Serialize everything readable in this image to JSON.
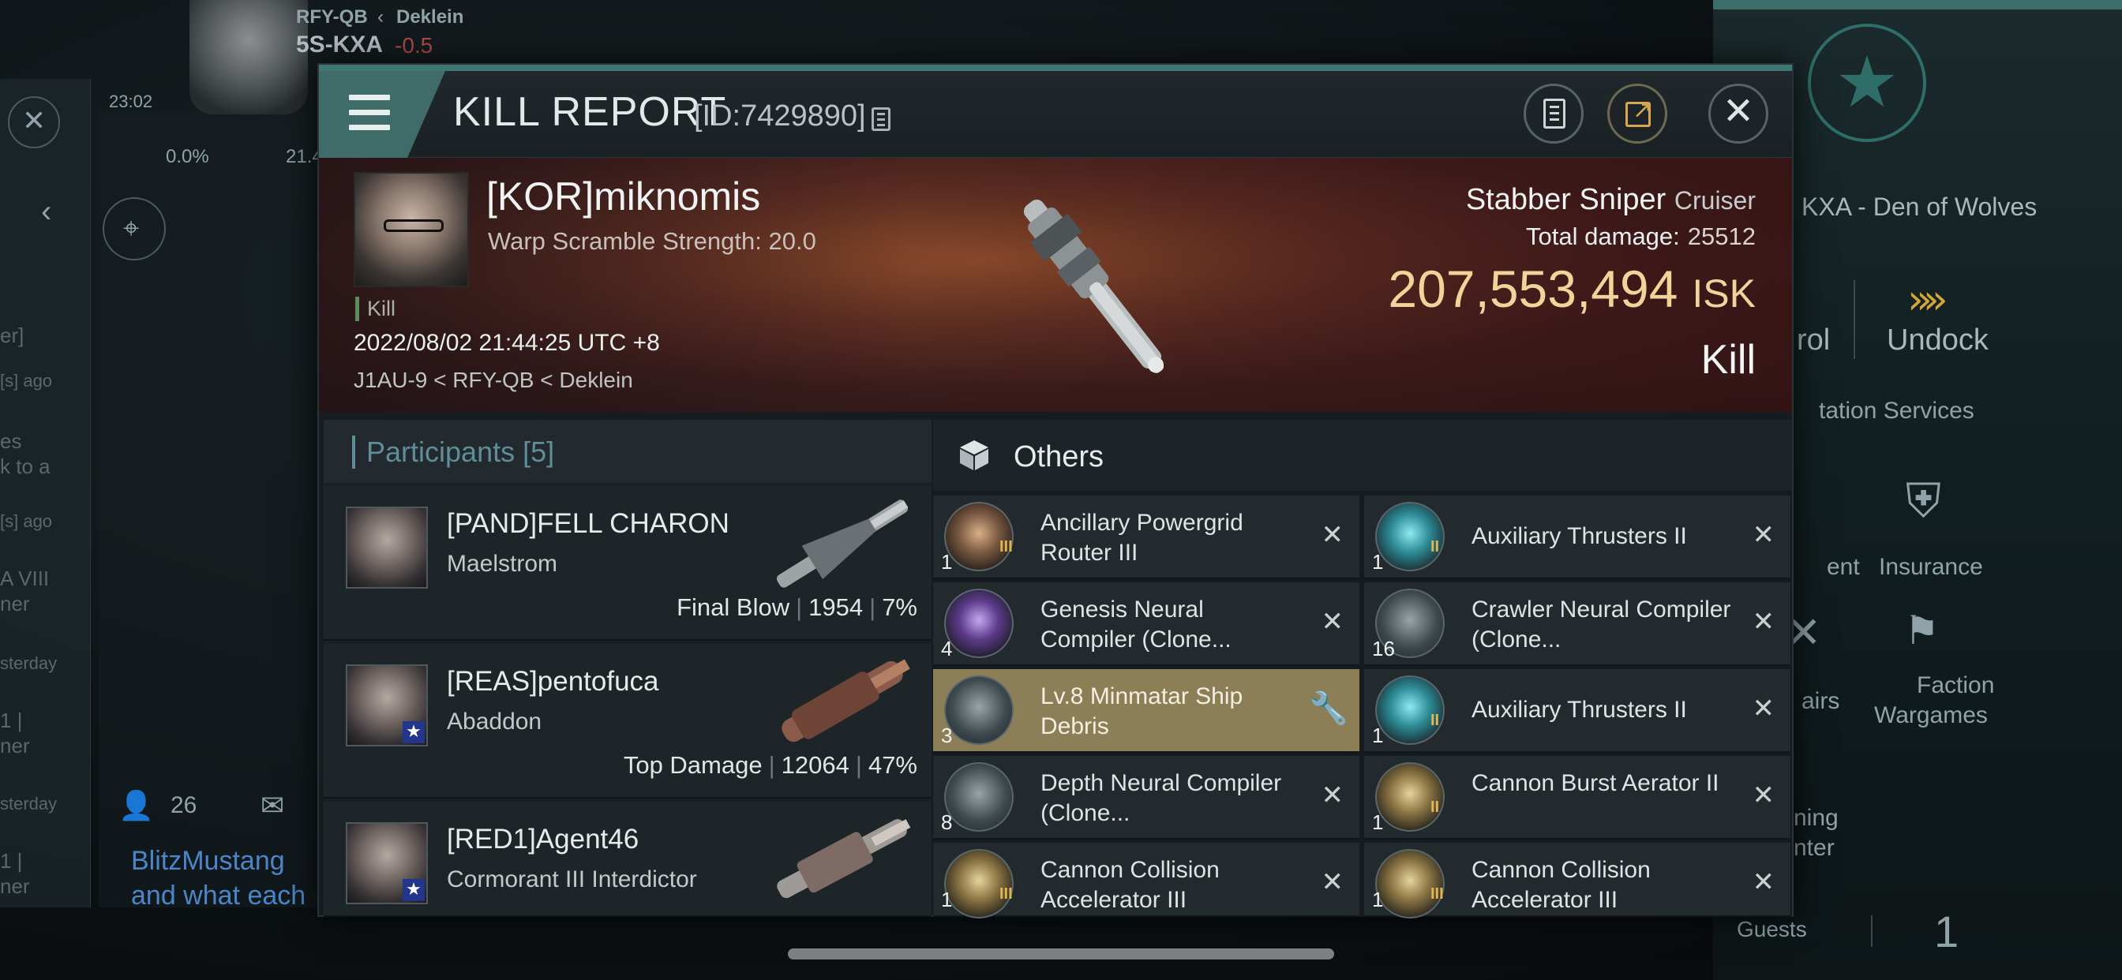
{
  "background": {
    "system_route": "RFY-QB",
    "region": "Deklein",
    "system": "5S-KXA",
    "security": "-0.5",
    "clock": "23:02",
    "percent": "0.0%",
    "partial_value": "21.4",
    "station_partial": "KXA - Den of Wolves",
    "patrol_partial": "rol",
    "undock": "Undock",
    "station_services_partial": "tation Services",
    "insurance": "Insurance",
    "agent_partial": "ent",
    "repairs_partial": "airs",
    "faction_wargames": "Faction Wargames",
    "training_partial": "ning",
    "center_partial": "nter",
    "guests": "Guests",
    "guest_count": "1",
    "contacts_count": "26",
    "chat_user": "BlitzMustang",
    "chat_text": "and what each",
    "chat_fragments": [
      "er]",
      "[s] ago",
      "es",
      "k to a",
      "[s] ago",
      "A VIII",
      "ner",
      "sterday",
      "1 |",
      "ner",
      "sterday",
      "1 |",
      "ner"
    ]
  },
  "modal": {
    "title": "KILL REPORT",
    "id_label": "[ID:7429890]",
    "victim": {
      "name": "[KOR]miknomis",
      "subtitle": "Warp Scramble Strength: 20.0",
      "kill_tag": "Kill",
      "timestamp": "2022/08/02 21:44:25 UTC +8",
      "location": "J1AU-9 < RFY-QB < Deklein"
    },
    "ship": {
      "name": "Stabber Sniper",
      "class": "Cruiser",
      "total_damage_label": "Total damage:",
      "total_damage": "25512",
      "isk_value": "207,553,494",
      "isk_unit": "ISK",
      "result": "Kill"
    },
    "participants": {
      "label": "Participants [5]",
      "rows": [
        {
          "name": "[PAND]FELL CHARON",
          "ship": "Maelstrom",
          "stat_label": "Final Blow",
          "damage": "1954",
          "percent": "7%"
        },
        {
          "name": "[REAS]pentofuca",
          "ship": "Abaddon",
          "stat_label": "Top Damage",
          "damage": "12064",
          "percent": "47%"
        },
        {
          "name": "[RED1]Agent46",
          "ship": "Cormorant III Interdictor"
        }
      ]
    },
    "others": {
      "label": "Others",
      "items_left": [
        {
          "name": "Ancillary Powergrid Router III",
          "qty": "1",
          "tier": "III",
          "icon": "powergrid-router-icon"
        },
        {
          "name": "Genesis Neural Compiler (Clone...",
          "qty": "4",
          "tier": "",
          "icon": "neural-compiler-icon"
        },
        {
          "name": "Lv.8 Minmatar Ship Debris",
          "qty": "3",
          "tier": "",
          "icon": "ship-debris-icon"
        },
        {
          "name": "Depth Neural Compiler (Clone...",
          "qty": "8",
          "tier": "",
          "icon": "neural-compiler-icon"
        },
        {
          "name": "Cannon Collision Accelerator III",
          "qty": "1",
          "tier": "III",
          "icon": "cannon-accelerator-icon"
        }
      ],
      "items_right": [
        {
          "name": "Auxiliary Thrusters II",
          "qty": "1",
          "tier": "II",
          "icon": "thruster-icon"
        },
        {
          "name": "Crawler Neural Compiler (Clone...",
          "qty": "16",
          "tier": "",
          "icon": "neural-compiler-icon"
        },
        {
          "name": "Auxiliary Thrusters II",
          "qty": "1",
          "tier": "II",
          "icon": "thruster-icon"
        },
        {
          "name": "Cannon Burst Aerator II",
          "qty": "1",
          "tier": "II",
          "icon": "cannon-aerator-icon"
        },
        {
          "name": "Cannon Collision Accelerator III",
          "qty": "1",
          "tier": "III",
          "icon": "cannon-accelerator-icon"
        }
      ]
    }
  }
}
